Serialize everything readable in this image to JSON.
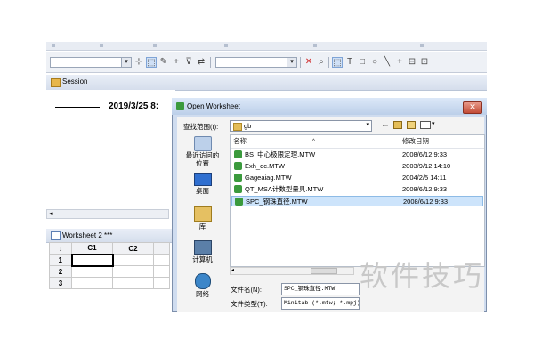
{
  "toolbar": {
    "combo1_value": "",
    "combo2_value": "",
    "tool_glyphs": [
      "✕",
      "🔍",
      "⬚",
      "T",
      "□",
      "○",
      "╲",
      "+",
      "⊟",
      "⊡"
    ]
  },
  "session": {
    "title": "Session",
    "timestamp": "2019/3/25 8:"
  },
  "worksheet": {
    "title": "Worksheet 2 ***",
    "columns": [
      "↓",
      "C1",
      "C2"
    ],
    "row_numbers": [
      "1",
      "2",
      "3"
    ]
  },
  "dialog": {
    "title": "Open Worksheet",
    "look_in_label": "查找范围(I):",
    "look_in_value": "gb",
    "places": [
      "最近访问的位置",
      "桌面",
      "库",
      "计算机",
      "网络"
    ],
    "columns": {
      "name": "名称",
      "modified": "修改日期"
    },
    "files": [
      {
        "name": "BS_中心极限定理.MTW",
        "date": "2008/6/12 9:33",
        "selected": false
      },
      {
        "name": "Exh_qc.MTW",
        "date": "2003/9/12 14:10",
        "selected": false
      },
      {
        "name": "Gageaiag.MTW",
        "date": "2004/2/5 14:11",
        "selected": false
      },
      {
        "name": "QT_MSA计数型量具.MTW",
        "date": "2008/6/12 9:33",
        "selected": false
      },
      {
        "name": "SPC_钢珠直径.MTW",
        "date": "2008/6/12 9:33",
        "selected": true
      }
    ],
    "filename_label": "文件名(N):",
    "filename_value": "SPC_钢珠直径.MTW",
    "filetype_label": "文件类型(T):",
    "filetype_value": "Minitab (*.mtw; *.mpj)"
  },
  "watermark": "软件技巧",
  "colors": {
    "selected_row": "#cde4fb",
    "file_icon": "#3b9a3d",
    "close_button": "#c24b35"
  }
}
